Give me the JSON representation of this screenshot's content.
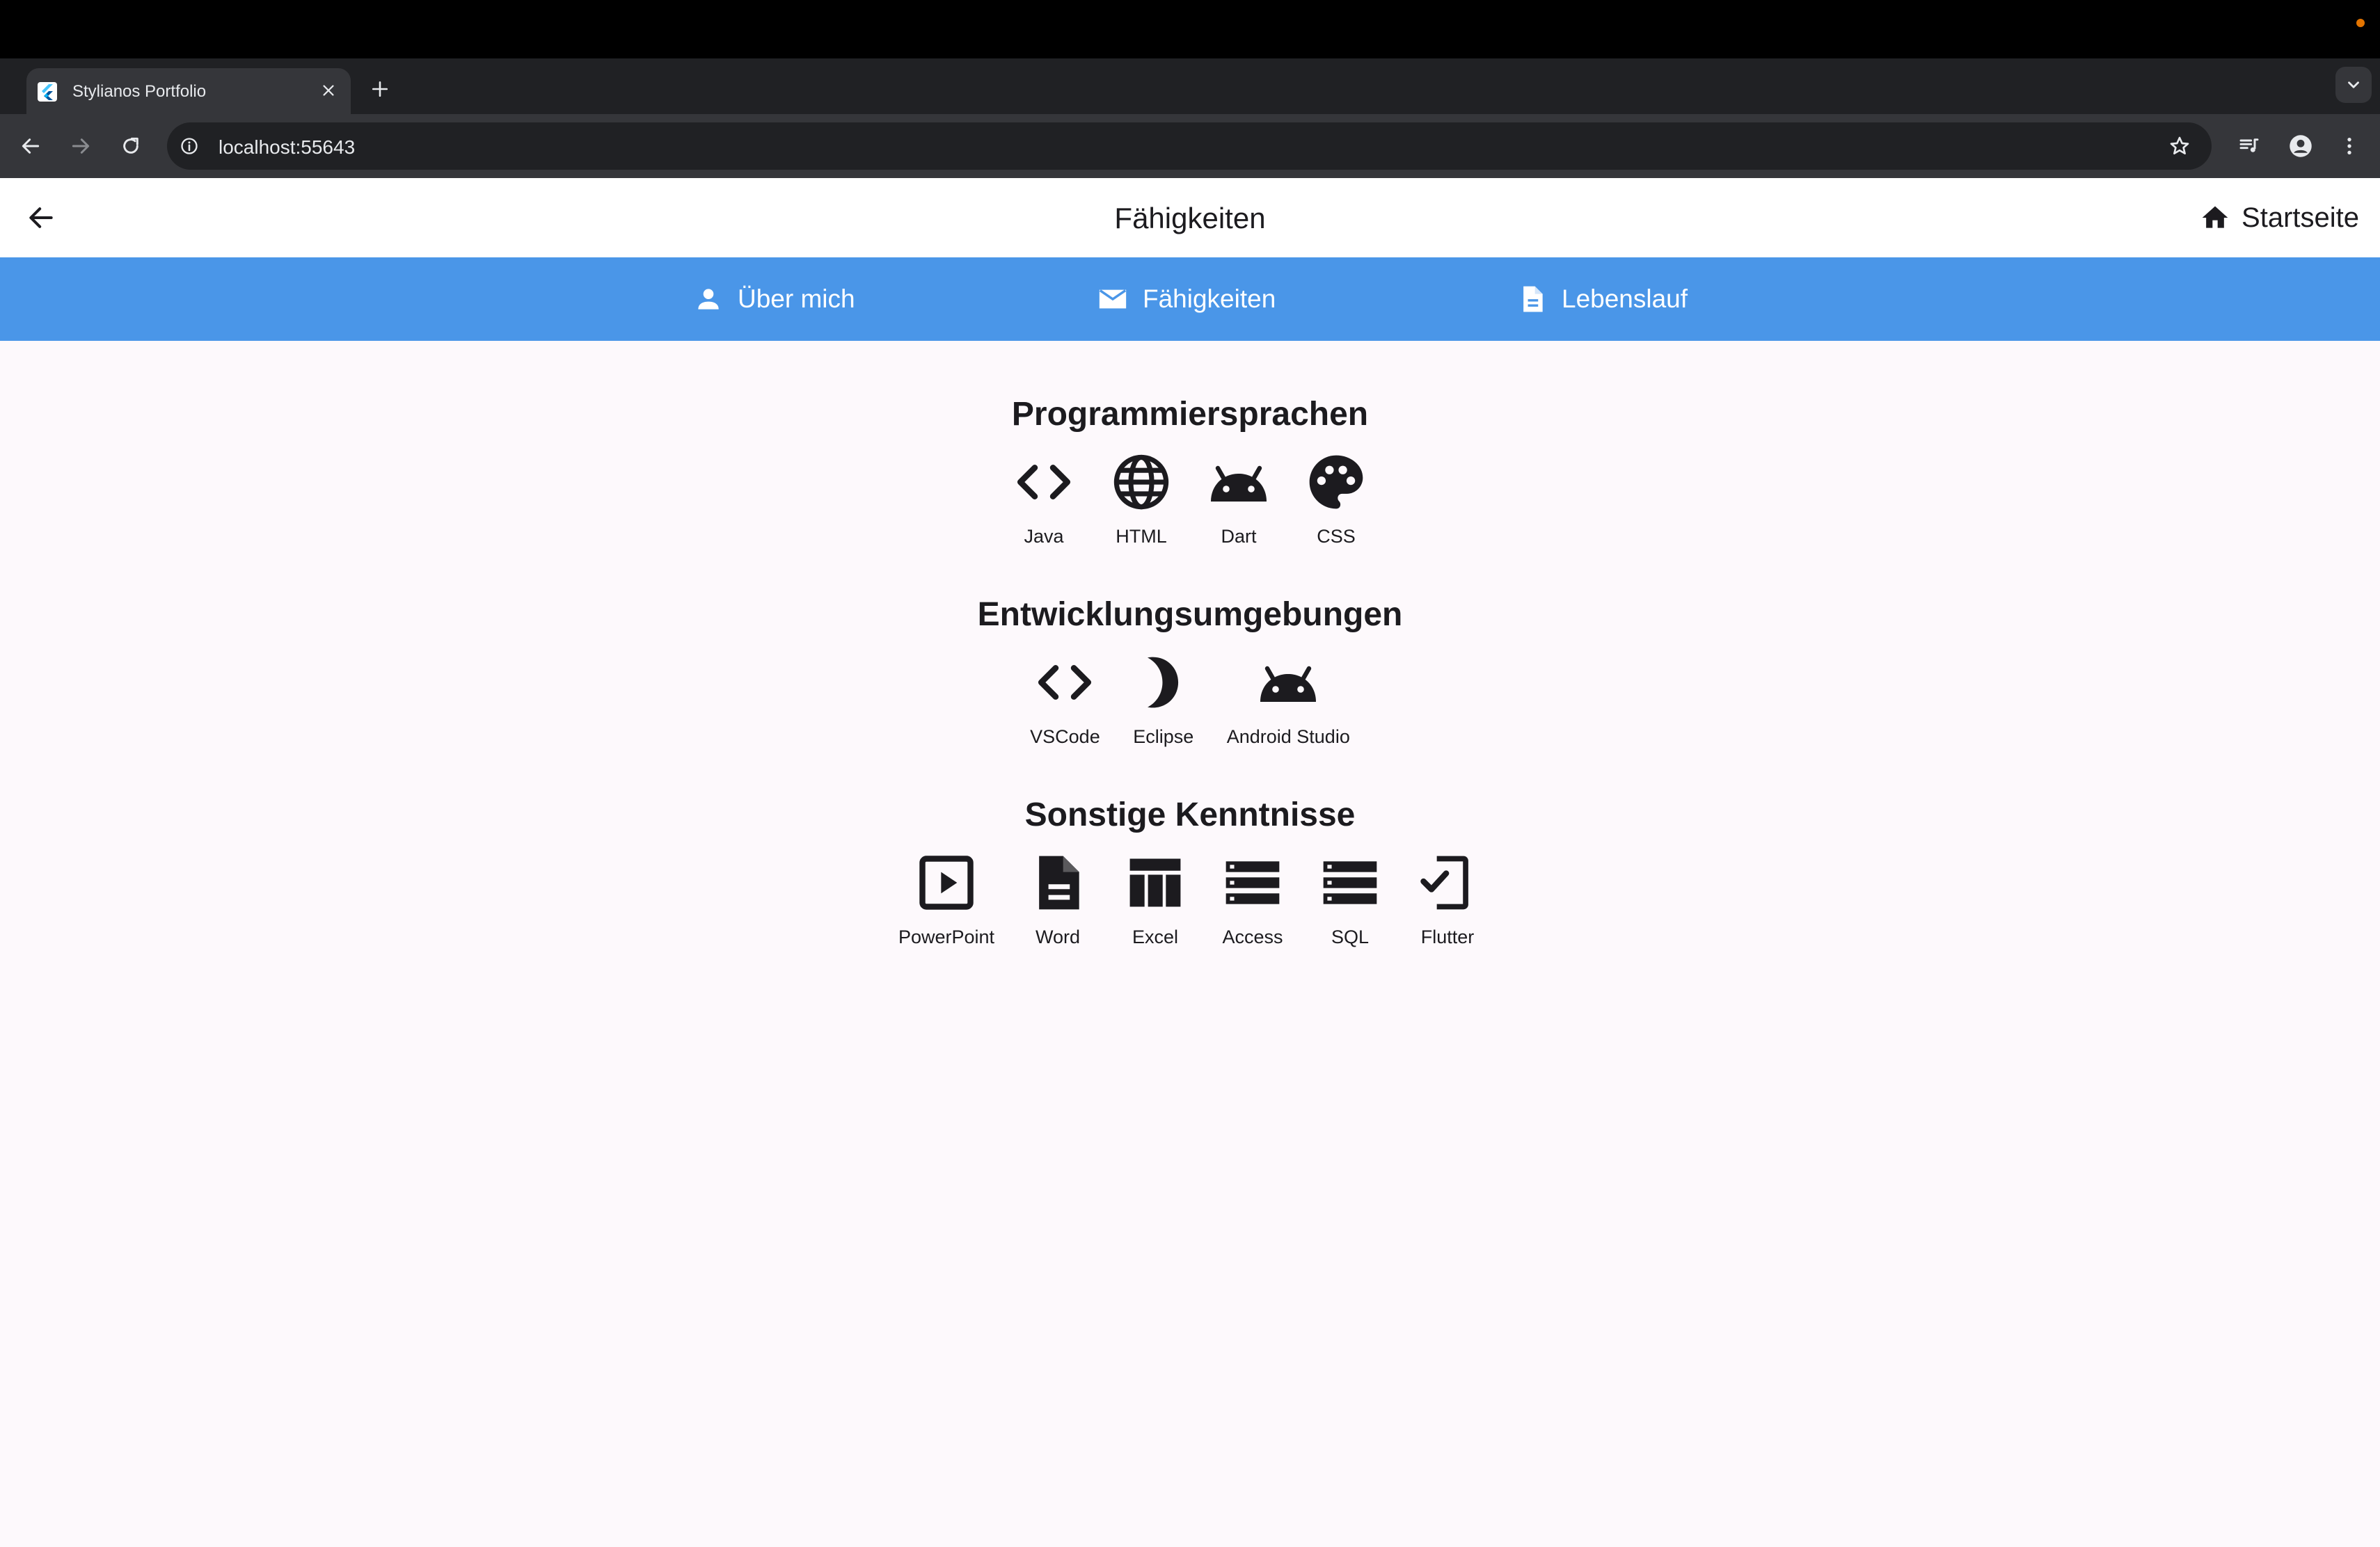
{
  "browser": {
    "tab_title": "Stylianos Portfolio",
    "url": "localhost:55643"
  },
  "appbar": {
    "title": "Fähigkeiten",
    "home_label": "Startseite"
  },
  "nav": {
    "tabs": [
      {
        "label": "Über mich",
        "icon": "person-icon"
      },
      {
        "label": "Fähigkeiten",
        "icon": "mail-icon"
      },
      {
        "label": "Lebenslauf",
        "icon": "description-icon"
      }
    ]
  },
  "sections": [
    {
      "title": "Programmiersprachen",
      "skills": [
        {
          "label": "Java",
          "icon": "code-icon"
        },
        {
          "label": "HTML",
          "icon": "language-icon"
        },
        {
          "label": "Dart",
          "icon": "android-icon"
        },
        {
          "label": "CSS",
          "icon": "palette-icon"
        }
      ]
    },
    {
      "title": "Entwicklungsumgebungen",
      "skills": [
        {
          "label": "VSCode",
          "icon": "code-icon"
        },
        {
          "label": "Eclipse",
          "icon": "moon-icon"
        },
        {
          "label": "Android Studio",
          "icon": "android-icon"
        }
      ]
    },
    {
      "title": "Sonstige Kenntnisse",
      "skills": [
        {
          "label": "PowerPoint",
          "icon": "slideshow-icon"
        },
        {
          "label": "Word",
          "icon": "description-icon"
        },
        {
          "label": "Excel",
          "icon": "table-icon"
        },
        {
          "label": "Access",
          "icon": "storage-icon"
        },
        {
          "label": "SQL",
          "icon": "storage-icon"
        },
        {
          "label": "Flutter",
          "icon": "phonelink-check-icon"
        }
      ]
    }
  ],
  "colors": {
    "nav_bar": "#4a96e8",
    "page_bg": "#fdf9fc",
    "text": "#1c1b1f",
    "notification_dot": "#e37400"
  }
}
